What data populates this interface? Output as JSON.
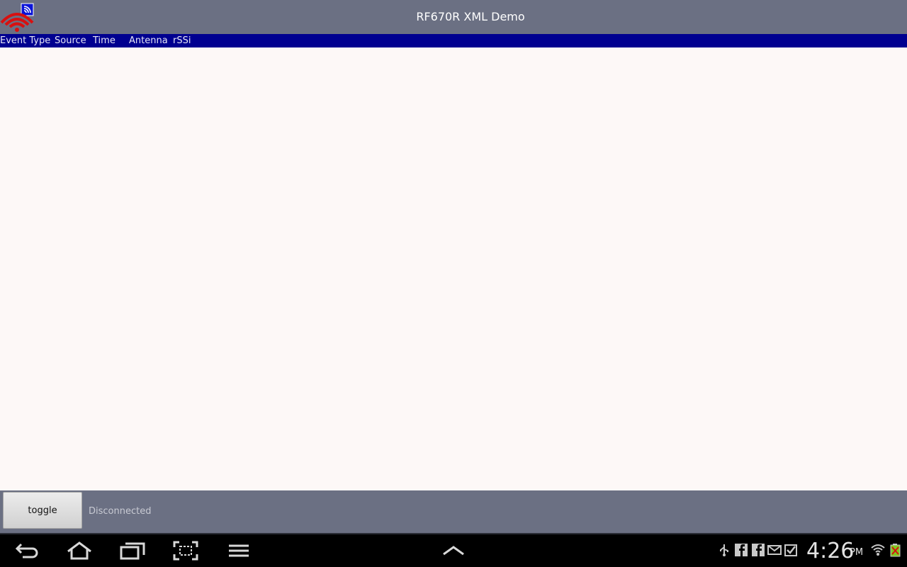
{
  "app": {
    "title": "RF670R XML Demo",
    "icon": "rfid-signal-icon"
  },
  "table_header": {
    "columns": [
      "Event Type",
      "Source",
      "Time",
      "Antenna",
      "rSSi"
    ]
  },
  "controls": {
    "toggle_label": "toggle",
    "status_text": "Disconnected"
  },
  "system_bar": {
    "time": "4:26",
    "ampm": "PM",
    "nav_icons": [
      "back-icon",
      "home-icon",
      "recent-apps-icon",
      "screenshot-icon",
      "menu-icon",
      "expand-up-icon"
    ],
    "notification_icons": [
      "usb-icon",
      "facebook-icon",
      "facebook-icon",
      "email-icon",
      "download-done-icon"
    ],
    "status_icons": [
      "wifi-icon",
      "battery-icon"
    ]
  },
  "colors": {
    "titlebar": "#6b7083",
    "header_row": "#000090",
    "content_bg": "#fdf8f7",
    "system_bar": "#000000"
  }
}
